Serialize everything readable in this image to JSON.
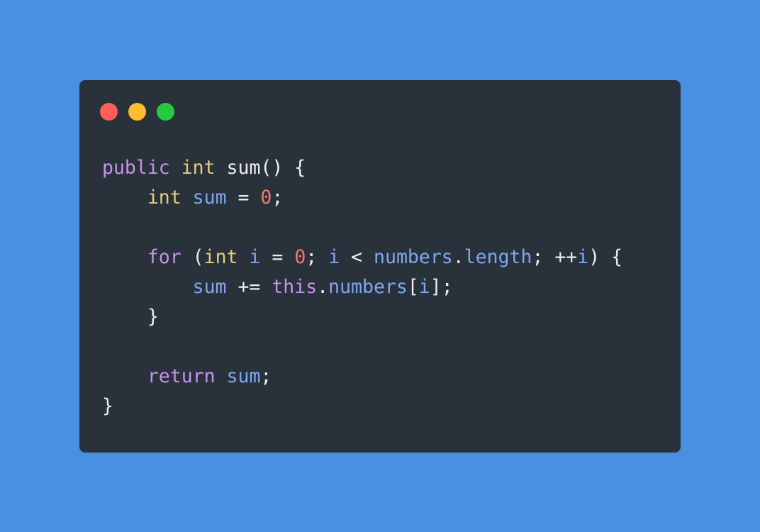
{
  "window": {
    "controls": {
      "close_color": "#ff5f56",
      "minimize_color": "#ffbd2e",
      "maximize_color": "#27c93f"
    },
    "colors": {
      "background": "#4a90e2",
      "panel": "#29323b",
      "keyword": "#c792ea",
      "type": "#e4cd79",
      "variable": "#7ea7f0",
      "number": "#f07868",
      "text": "#eeeeee"
    }
  },
  "code": {
    "lines": [
      [
        {
          "t": "public",
          "c": "kw"
        },
        {
          "t": " ",
          "c": "pun"
        },
        {
          "t": "int",
          "c": "type"
        },
        {
          "t": " sum() {",
          "c": "pun"
        }
      ],
      [
        {
          "t": "    ",
          "c": "pun"
        },
        {
          "t": "int",
          "c": "type"
        },
        {
          "t": " ",
          "c": "pun"
        },
        {
          "t": "sum",
          "c": "var"
        },
        {
          "t": " = ",
          "c": "pun"
        },
        {
          "t": "0",
          "c": "num"
        },
        {
          "t": ";",
          "c": "pun"
        }
      ],
      [],
      [
        {
          "t": "    ",
          "c": "pun"
        },
        {
          "t": "for",
          "c": "kw"
        },
        {
          "t": " (",
          "c": "pun"
        },
        {
          "t": "int",
          "c": "type"
        },
        {
          "t": " ",
          "c": "pun"
        },
        {
          "t": "i",
          "c": "var"
        },
        {
          "t": " = ",
          "c": "pun"
        },
        {
          "t": "0",
          "c": "num"
        },
        {
          "t": "; ",
          "c": "pun"
        },
        {
          "t": "i",
          "c": "var"
        },
        {
          "t": " < ",
          "c": "pun"
        },
        {
          "t": "numbers",
          "c": "var"
        },
        {
          "t": ".",
          "c": "pun"
        },
        {
          "t": "length",
          "c": "var"
        },
        {
          "t": "; ++",
          "c": "pun"
        },
        {
          "t": "i",
          "c": "var"
        },
        {
          "t": ") {",
          "c": "pun"
        }
      ],
      [
        {
          "t": "        ",
          "c": "pun"
        },
        {
          "t": "sum",
          "c": "var"
        },
        {
          "t": " += ",
          "c": "pun"
        },
        {
          "t": "this",
          "c": "kw"
        },
        {
          "t": ".",
          "c": "pun"
        },
        {
          "t": "numbers",
          "c": "var"
        },
        {
          "t": "[",
          "c": "pun"
        },
        {
          "t": "i",
          "c": "var"
        },
        {
          "t": "];",
          "c": "pun"
        }
      ],
      [
        {
          "t": "    }",
          "c": "pun"
        }
      ],
      [],
      [
        {
          "t": "    ",
          "c": "pun"
        },
        {
          "t": "return",
          "c": "kw"
        },
        {
          "t": " ",
          "c": "pun"
        },
        {
          "t": "sum",
          "c": "var"
        },
        {
          "t": ";",
          "c": "pun"
        }
      ],
      [
        {
          "t": "}",
          "c": "pun"
        }
      ]
    ]
  }
}
